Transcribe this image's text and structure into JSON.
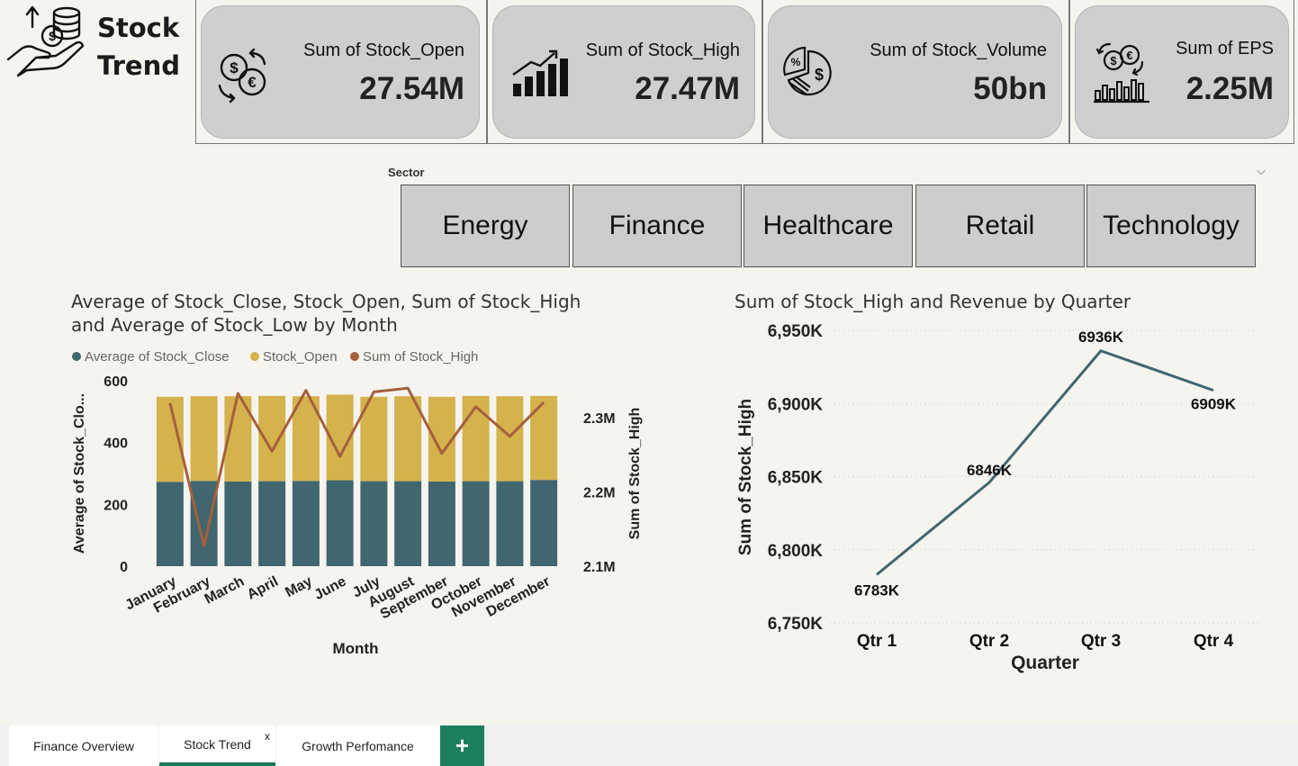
{
  "app": {
    "title_line1": "Stock",
    "title_line2": "Trend"
  },
  "kpis": [
    {
      "label": "Sum of Stock_Open",
      "value": "27.54M",
      "icon": "currency-exchange-icon"
    },
    {
      "label": "Sum of Stock_High",
      "value": "27.47M",
      "icon": "bar-chart-growth-icon"
    },
    {
      "label": "Sum of Stock_Volume",
      "value": "50bn",
      "icon": "pie-percent-dollar-icon"
    },
    {
      "label": "Sum of EPS",
      "value": "2.25M",
      "icon": "coins-bar-chart-icon"
    }
  ],
  "slicer": {
    "title": "Sector",
    "options": [
      "Energy",
      "Finance",
      "Healthcare",
      "Retail",
      "Technology"
    ]
  },
  "colors": {
    "close": "#40666f",
    "open": "#d4b24c",
    "high_line": "#a5603b",
    "quarter_line": "#40666f",
    "tab_accent": "#1d7f60"
  },
  "chart_data": [
    {
      "type": "bar",
      "title": "Average of Stock_Close, Stock_Open, Sum of Stock_High and Average of Stock_Low by Month",
      "title_line1": "Average of Stock_Close, Stock_Open, Sum of Stock_High",
      "title_line2": "and Average of Stock_Low by Month",
      "stacked": true,
      "xlabel": "Month",
      "ylabel": "Average of Stock_Clo...",
      "y2label": "Sum of Stock_High",
      "ylim": [
        0,
        600
      ],
      "y2lim": [
        2100000,
        2350000
      ],
      "yticks": [
        "0",
        "200",
        "400",
        "600"
      ],
      "y2ticks": [
        "2.1M",
        "2.2M",
        "2.3M"
      ],
      "legend_position": "top-left",
      "categories": [
        "January",
        "February",
        "March",
        "April",
        "May",
        "June",
        "July",
        "August",
        "September",
        "October",
        "November",
        "December"
      ],
      "series": [
        {
          "name": "Average of Stock_Close",
          "kind": "bar",
          "values": [
            273,
            276,
            274,
            275,
            276,
            278,
            275,
            275,
            274,
            275,
            275,
            279
          ]
        },
        {
          "name": "Stock_Open",
          "kind": "bar",
          "values": [
            275,
            274,
            276,
            276,
            274,
            277,
            273,
            275,
            274,
            276,
            275,
            272
          ]
        },
        {
          "name": "Sum of Stock_High",
          "kind": "line",
          "axis": "secondary",
          "values": [
            2320000,
            2127000,
            2333000,
            2255000,
            2337000,
            2248000,
            2335000,
            2340000,
            2252000,
            2315000,
            2275000,
            2321000
          ]
        }
      ]
    },
    {
      "type": "line",
      "title": "Sum of Stock_High and Revenue by Quarter",
      "xlabel": "Quarter",
      "ylabel": "Sum of Stock_High",
      "ylim": [
        6750,
        6950
      ],
      "yticks": [
        "6,750K",
        "6,800K",
        "6,850K",
        "6,900K",
        "6,950K"
      ],
      "categories": [
        "Qtr 1",
        "Qtr 2",
        "Qtr 3",
        "Qtr 4"
      ],
      "series": [
        {
          "name": "Sum of Stock_High",
          "values": [
            6783,
            6846,
            6936,
            6909
          ],
          "labels": [
            "6783K",
            "6846K",
            "6936K",
            "6909K"
          ]
        }
      ]
    }
  ],
  "tabs": [
    {
      "label": "Finance Overview",
      "active": false
    },
    {
      "label": "Stock Trend",
      "active": true,
      "close": "x"
    },
    {
      "label": "Growth Perfomance",
      "active": false
    }
  ],
  "add_tab_label": "+"
}
